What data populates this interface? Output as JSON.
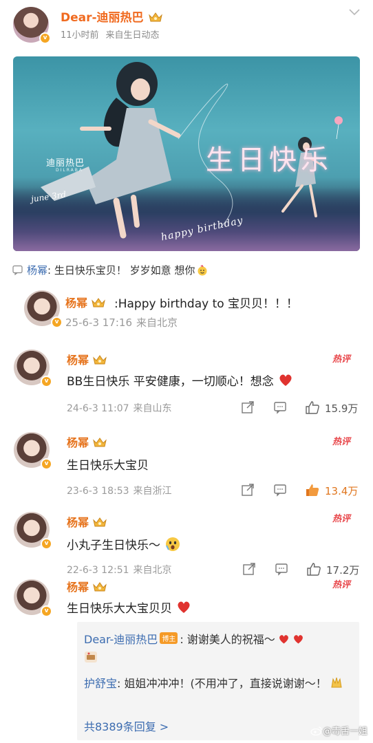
{
  "post": {
    "author": "Dear-迪丽热巴",
    "time": "11小时前",
    "source": "来自生日动态",
    "liked_by_name": "杨幂",
    "liked_by_text": ": 生日快乐宝贝！ 岁岁如意 想你"
  },
  "banner": {
    "logo": "迪丽热巴",
    "logo_sub": "DILRABA",
    "june": "june 3rd",
    "title": "生日快乐",
    "happy_birthday": "happy birthday"
  },
  "comments": [
    {
      "name": "杨幂",
      "text": ":Happy birthday to 宝贝贝！！！",
      "date": "25-6-3 17:16",
      "location": "来自北京",
      "hot": false,
      "likes": ""
    },
    {
      "name": "杨幂",
      "text": "BB生日快乐 平安健康，一切顺心！想念",
      "date": "24-6-3 11:07",
      "location": "来自山东",
      "hot": true,
      "hot_label": "热评",
      "likes": "15.9万"
    },
    {
      "name": "杨幂",
      "text": "生日快乐大宝贝",
      "date": "23-6-3 18:53",
      "location": "来自浙江",
      "hot": true,
      "hot_label": "热评",
      "likes": "13.4万"
    },
    {
      "name": "杨幂",
      "text": "小丸子生日快乐～",
      "date": "22-6-3 12:51",
      "location": "来自北京",
      "hot": true,
      "hot_label": "热评",
      "likes": "17.2万"
    },
    {
      "name": "杨幂",
      "text": "生日快乐大大宝贝贝",
      "hot": true,
      "hot_label": "热评"
    }
  ],
  "replies": {
    "r1_name": "Dear-迪丽热巴",
    "r1_badge": "博主",
    "r1_text": ": 谢谢美人的祝福～",
    "r2_name": "护舒宝",
    "r2_text": ": 姐姐冲冲冲！(不用冲了，直接说谢谢～！",
    "more": "共8389条回复 >"
  },
  "watermark": "@毒舌一姐",
  "colors": {
    "name_orange": "#e6741e",
    "link_blue": "#3c6cb0",
    "hot_red": "#e8474b",
    "verified": "#f5a623"
  }
}
